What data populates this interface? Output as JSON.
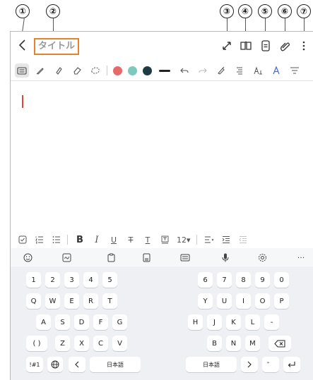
{
  "callouts": [
    "①",
    "②",
    "③",
    "④",
    "⑤",
    "⑥",
    "⑦"
  ],
  "appbar": {
    "back_icon": "chevron-left-icon",
    "title_placeholder": "タイトル",
    "icons": [
      "expand-icon",
      "book-icon",
      "note-list-icon",
      "attach-icon",
      "more-vert-icon"
    ]
  },
  "toolbar": {
    "tools": [
      "keyboard-mode-icon",
      "pen-icon",
      "highlighter-icon",
      "eraser-icon",
      "lasso-icon"
    ],
    "colors": [
      "#e56a6a",
      "#7cc9bf",
      "#1e3a44"
    ],
    "actions": [
      "line-thickness-icon",
      "undo-icon",
      "redo-icon",
      "pen-settings-icon",
      "text-align-icon",
      "font-size-icon",
      "text-style-icon",
      "format-icon"
    ]
  },
  "formatbar": {
    "font_size": "12▾"
  },
  "keyboard": {
    "toolbar": [
      "emoji-icon",
      "handwriting-icon",
      "clipboard-icon",
      "split-icon",
      "keyboard-icon",
      "mic-icon",
      "settings-icon",
      "more-icon"
    ],
    "more_label": "···",
    "row_numbers_left": [
      "1",
      "2",
      "3",
      "4",
      "5"
    ],
    "row_numbers_right": [
      "6",
      "7",
      "8",
      "9",
      "0"
    ],
    "row_q_left": [
      "Q",
      "W",
      "E",
      "R",
      "T"
    ],
    "row_q_right": [
      "Y",
      "U",
      "I",
      "O",
      "P"
    ],
    "row_a_left": [
      "A",
      "S",
      "D",
      "F",
      "G"
    ],
    "row_a_right": [
      "H",
      "J",
      "K",
      "L",
      "-"
    ],
    "row_z_left": [
      "( )",
      "Z",
      "X",
      "C",
      "V"
    ],
    "row_z_right": [
      "B",
      "N",
      "M"
    ],
    "sym_label": "!#1",
    "lang_label": "日本語",
    "lang_label_right": "日本語",
    "dakuten_label": "゛"
  }
}
